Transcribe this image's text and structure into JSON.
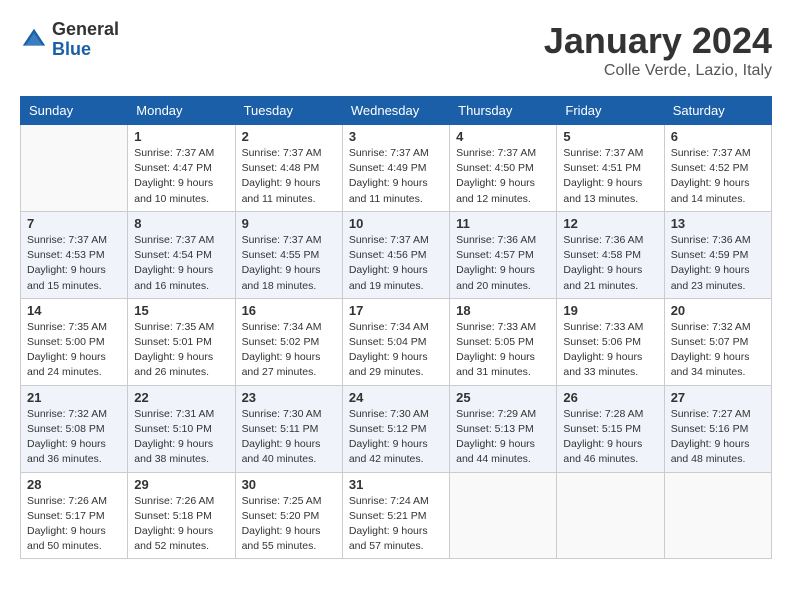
{
  "header": {
    "logo_general": "General",
    "logo_blue": "Blue",
    "month_title": "January 2024",
    "location": "Colle Verde, Lazio, Italy"
  },
  "weekdays": [
    "Sunday",
    "Monday",
    "Tuesday",
    "Wednesday",
    "Thursday",
    "Friday",
    "Saturday"
  ],
  "weeks": [
    [
      {
        "day": "",
        "sunrise": "",
        "sunset": "",
        "daylight": ""
      },
      {
        "day": "1",
        "sunrise": "Sunrise: 7:37 AM",
        "sunset": "Sunset: 4:47 PM",
        "daylight": "Daylight: 9 hours and 10 minutes."
      },
      {
        "day": "2",
        "sunrise": "Sunrise: 7:37 AM",
        "sunset": "Sunset: 4:48 PM",
        "daylight": "Daylight: 9 hours and 11 minutes."
      },
      {
        "day": "3",
        "sunrise": "Sunrise: 7:37 AM",
        "sunset": "Sunset: 4:49 PM",
        "daylight": "Daylight: 9 hours and 11 minutes."
      },
      {
        "day": "4",
        "sunrise": "Sunrise: 7:37 AM",
        "sunset": "Sunset: 4:50 PM",
        "daylight": "Daylight: 9 hours and 12 minutes."
      },
      {
        "day": "5",
        "sunrise": "Sunrise: 7:37 AM",
        "sunset": "Sunset: 4:51 PM",
        "daylight": "Daylight: 9 hours and 13 minutes."
      },
      {
        "day": "6",
        "sunrise": "Sunrise: 7:37 AM",
        "sunset": "Sunset: 4:52 PM",
        "daylight": "Daylight: 9 hours and 14 minutes."
      }
    ],
    [
      {
        "day": "7",
        "sunrise": "Sunrise: 7:37 AM",
        "sunset": "Sunset: 4:53 PM",
        "daylight": "Daylight: 9 hours and 15 minutes."
      },
      {
        "day": "8",
        "sunrise": "Sunrise: 7:37 AM",
        "sunset": "Sunset: 4:54 PM",
        "daylight": "Daylight: 9 hours and 16 minutes."
      },
      {
        "day": "9",
        "sunrise": "Sunrise: 7:37 AM",
        "sunset": "Sunset: 4:55 PM",
        "daylight": "Daylight: 9 hours and 18 minutes."
      },
      {
        "day": "10",
        "sunrise": "Sunrise: 7:37 AM",
        "sunset": "Sunset: 4:56 PM",
        "daylight": "Daylight: 9 hours and 19 minutes."
      },
      {
        "day": "11",
        "sunrise": "Sunrise: 7:36 AM",
        "sunset": "Sunset: 4:57 PM",
        "daylight": "Daylight: 9 hours and 20 minutes."
      },
      {
        "day": "12",
        "sunrise": "Sunrise: 7:36 AM",
        "sunset": "Sunset: 4:58 PM",
        "daylight": "Daylight: 9 hours and 21 minutes."
      },
      {
        "day": "13",
        "sunrise": "Sunrise: 7:36 AM",
        "sunset": "Sunset: 4:59 PM",
        "daylight": "Daylight: 9 hours and 23 minutes."
      }
    ],
    [
      {
        "day": "14",
        "sunrise": "Sunrise: 7:35 AM",
        "sunset": "Sunset: 5:00 PM",
        "daylight": "Daylight: 9 hours and 24 minutes."
      },
      {
        "day": "15",
        "sunrise": "Sunrise: 7:35 AM",
        "sunset": "Sunset: 5:01 PM",
        "daylight": "Daylight: 9 hours and 26 minutes."
      },
      {
        "day": "16",
        "sunrise": "Sunrise: 7:34 AM",
        "sunset": "Sunset: 5:02 PM",
        "daylight": "Daylight: 9 hours and 27 minutes."
      },
      {
        "day": "17",
        "sunrise": "Sunrise: 7:34 AM",
        "sunset": "Sunset: 5:04 PM",
        "daylight": "Daylight: 9 hours and 29 minutes."
      },
      {
        "day": "18",
        "sunrise": "Sunrise: 7:33 AM",
        "sunset": "Sunset: 5:05 PM",
        "daylight": "Daylight: 9 hours and 31 minutes."
      },
      {
        "day": "19",
        "sunrise": "Sunrise: 7:33 AM",
        "sunset": "Sunset: 5:06 PM",
        "daylight": "Daylight: 9 hours and 33 minutes."
      },
      {
        "day": "20",
        "sunrise": "Sunrise: 7:32 AM",
        "sunset": "Sunset: 5:07 PM",
        "daylight": "Daylight: 9 hours and 34 minutes."
      }
    ],
    [
      {
        "day": "21",
        "sunrise": "Sunrise: 7:32 AM",
        "sunset": "Sunset: 5:08 PM",
        "daylight": "Daylight: 9 hours and 36 minutes."
      },
      {
        "day": "22",
        "sunrise": "Sunrise: 7:31 AM",
        "sunset": "Sunset: 5:10 PM",
        "daylight": "Daylight: 9 hours and 38 minutes."
      },
      {
        "day": "23",
        "sunrise": "Sunrise: 7:30 AM",
        "sunset": "Sunset: 5:11 PM",
        "daylight": "Daylight: 9 hours and 40 minutes."
      },
      {
        "day": "24",
        "sunrise": "Sunrise: 7:30 AM",
        "sunset": "Sunset: 5:12 PM",
        "daylight": "Daylight: 9 hours and 42 minutes."
      },
      {
        "day": "25",
        "sunrise": "Sunrise: 7:29 AM",
        "sunset": "Sunset: 5:13 PM",
        "daylight": "Daylight: 9 hours and 44 minutes."
      },
      {
        "day": "26",
        "sunrise": "Sunrise: 7:28 AM",
        "sunset": "Sunset: 5:15 PM",
        "daylight": "Daylight: 9 hours and 46 minutes."
      },
      {
        "day": "27",
        "sunrise": "Sunrise: 7:27 AM",
        "sunset": "Sunset: 5:16 PM",
        "daylight": "Daylight: 9 hours and 48 minutes."
      }
    ],
    [
      {
        "day": "28",
        "sunrise": "Sunrise: 7:26 AM",
        "sunset": "Sunset: 5:17 PM",
        "daylight": "Daylight: 9 hours and 50 minutes."
      },
      {
        "day": "29",
        "sunrise": "Sunrise: 7:26 AM",
        "sunset": "Sunset: 5:18 PM",
        "daylight": "Daylight: 9 hours and 52 minutes."
      },
      {
        "day": "30",
        "sunrise": "Sunrise: 7:25 AM",
        "sunset": "Sunset: 5:20 PM",
        "daylight": "Daylight: 9 hours and 55 minutes."
      },
      {
        "day": "31",
        "sunrise": "Sunrise: 7:24 AM",
        "sunset": "Sunset: 5:21 PM",
        "daylight": "Daylight: 9 hours and 57 minutes."
      },
      {
        "day": "",
        "sunrise": "",
        "sunset": "",
        "daylight": ""
      },
      {
        "day": "",
        "sunrise": "",
        "sunset": "",
        "daylight": ""
      },
      {
        "day": "",
        "sunrise": "",
        "sunset": "",
        "daylight": ""
      }
    ]
  ]
}
